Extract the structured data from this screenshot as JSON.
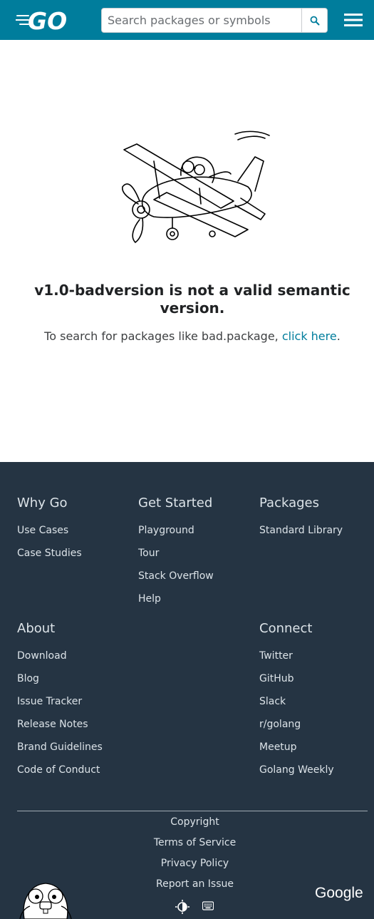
{
  "header": {
    "logo_text": "GO",
    "search_placeholder": "Search packages or symbols"
  },
  "error": {
    "title": "v1.0-badversion is not a valid semantic version.",
    "hint_prefix": "To search for packages like bad.package, ",
    "hint_link": "click here",
    "hint_suffix": "."
  },
  "footer": {
    "why_go": {
      "heading": "Why Go",
      "links": [
        "Use Cases",
        "Case Studies"
      ]
    },
    "get_started": {
      "heading": "Get Started",
      "links": [
        "Playground",
        "Tour",
        "Stack Overflow",
        "Help"
      ]
    },
    "packages": {
      "heading": "Packages",
      "links": [
        "Standard Library"
      ]
    },
    "about": {
      "heading": "About",
      "links": [
        "Download",
        "Blog",
        "Issue Tracker",
        "Release Notes",
        "Brand Guidelines",
        "Code of Conduct"
      ]
    },
    "connect": {
      "heading": "Connect",
      "links": [
        "Twitter",
        "GitHub",
        "Slack",
        "r/golang",
        "Meetup",
        "Golang Weekly"
      ]
    },
    "legal": [
      "Copyright",
      "Terms of Service",
      "Privacy Policy",
      "Report an Issue"
    ],
    "google_logo": "Google"
  }
}
